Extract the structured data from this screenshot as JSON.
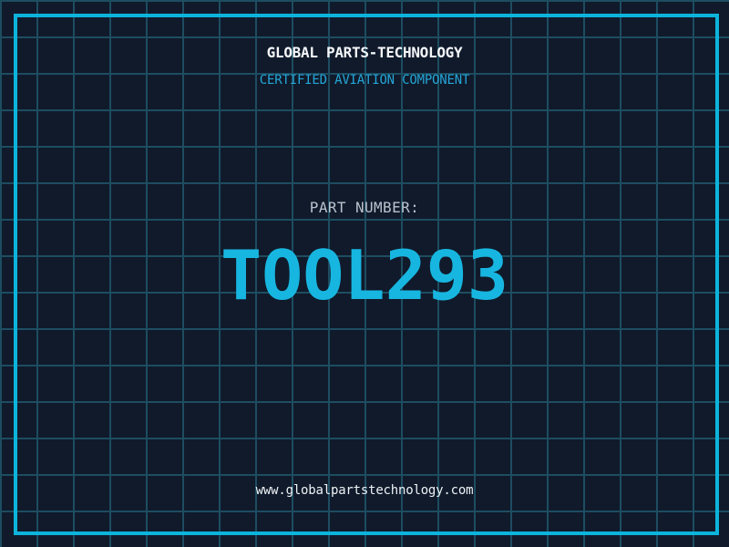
{
  "header": {
    "title": "GLOBAL PARTS-TECHNOLOGY",
    "subtitle": "CERTIFIED AVIATION COMPONENT"
  },
  "part": {
    "label": "PART NUMBER:",
    "number": "TOOL293"
  },
  "footer": {
    "website": "www.globalpartstechnology.com"
  },
  "colors": {
    "background": "#101a2b",
    "grid_line": "#1d4d61",
    "frame": "#0cb4dc",
    "title": "#f5f7fa",
    "subtitle": "#25a5d6",
    "part_label": "#b9c3cd",
    "part_number": "#17b6e0",
    "website": "#eef2f5"
  }
}
